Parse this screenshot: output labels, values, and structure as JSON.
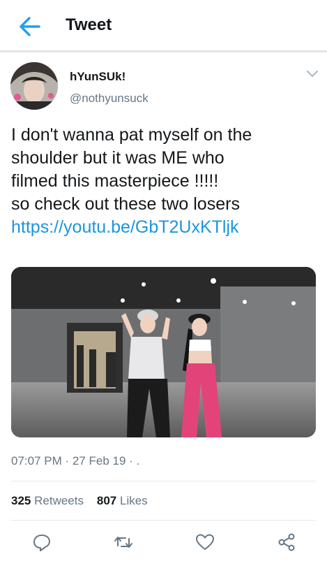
{
  "header": {
    "title": "Tweet",
    "back_icon": "back-arrow-icon"
  },
  "author": {
    "name": "hYunSUk!",
    "handle": "@nothyunsuck"
  },
  "tweet": {
    "lines": [
      "I don't wanna pat myself on the",
      "shoulder but it was ME who",
      "filmed this masterpiece !!!!!",
      "so check out these two losers"
    ],
    "link": "https://youtu.be/GbT2UxKTljk"
  },
  "meta": {
    "time": "07:07 PM",
    "date": "27 Feb 19",
    "trail": "·  ."
  },
  "stats": {
    "retweets_count": "325",
    "retweets_label": "Retweets",
    "likes_count": "807",
    "likes_label": "Likes"
  },
  "colors": {
    "accent": "#1b95e0",
    "muted": "#657786",
    "text": "#14171a"
  },
  "actions": [
    "reply-icon",
    "retweet-icon",
    "like-icon",
    "share-icon"
  ]
}
